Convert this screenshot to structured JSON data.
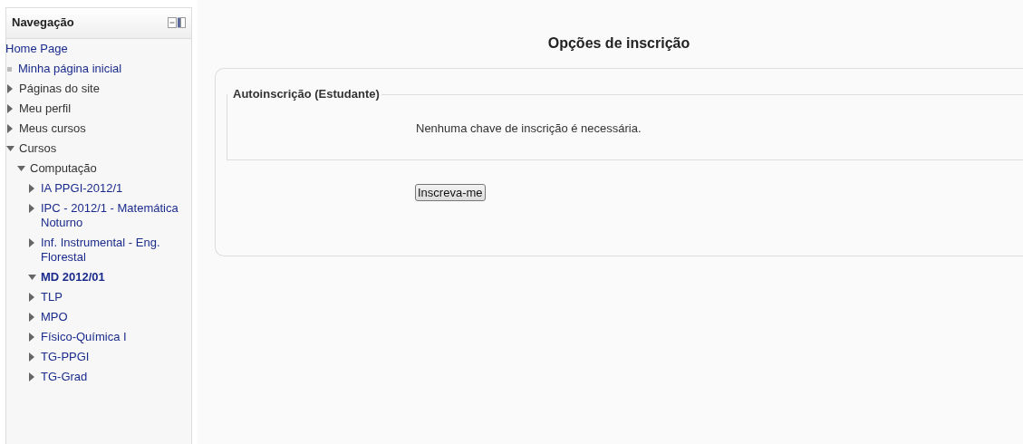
{
  "navigation": {
    "title": "Navegação",
    "items": [
      {
        "label": "Home Page",
        "kind": "home"
      },
      {
        "label": "Minha página inicial",
        "kind": "page"
      },
      {
        "label": "Páginas do site",
        "kind": "category",
        "expanded": false
      },
      {
        "label": "Meu perfil",
        "kind": "category",
        "expanded": false
      },
      {
        "label": "Meus cursos",
        "kind": "category",
        "expanded": false
      },
      {
        "label": "Cursos",
        "kind": "category",
        "expanded": true,
        "children": [
          {
            "label": "Computação",
            "kind": "category",
            "expanded": true,
            "children": [
              {
                "label": "IA PPGI-2012/1",
                "kind": "course",
                "expanded": false,
                "selected": false
              },
              {
                "label": "IPC - 2012/1 - Matemática Noturno",
                "kind": "course",
                "expanded": false,
                "selected": false
              },
              {
                "label": "Inf. Instrumental - Eng. Florestal",
                "kind": "course",
                "expanded": false,
                "selected": false
              },
              {
                "label": "MD 2012/01",
                "kind": "course",
                "expanded": true,
                "selected": true
              },
              {
                "label": "TLP",
                "kind": "course",
                "expanded": false,
                "selected": false
              },
              {
                "label": "MPO",
                "kind": "course",
                "expanded": false,
                "selected": false
              },
              {
                "label": "Físico-Química I",
                "kind": "course",
                "expanded": false,
                "selected": false
              },
              {
                "label": "TG-PPGI",
                "kind": "course",
                "expanded": false,
                "selected": false
              },
              {
                "label": "TG-Grad",
                "kind": "course",
                "expanded": false,
                "selected": false
              }
            ]
          }
        ]
      }
    ]
  },
  "main": {
    "title": "Opções de inscrição",
    "fieldset": {
      "legend": "Autoinscrição (Estudante)",
      "message": "Nenhuma chave de inscrição é necessária."
    },
    "button": "Inscreva-me"
  }
}
